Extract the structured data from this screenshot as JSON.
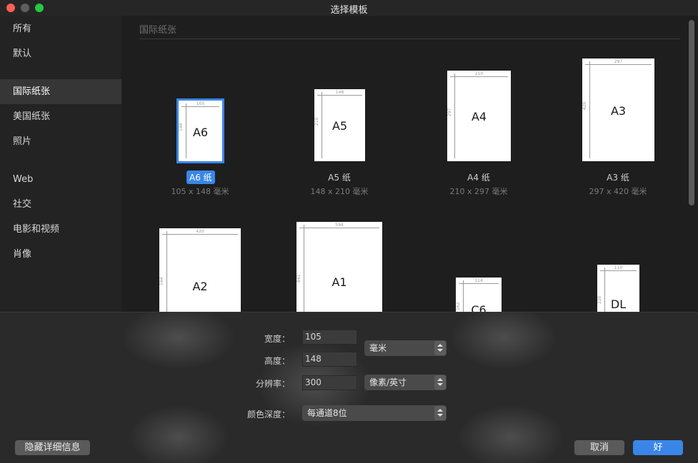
{
  "window": {
    "title": "选择模板"
  },
  "sidebar": {
    "items": [
      {
        "label": "所有"
      },
      {
        "label": "默认"
      },
      {
        "label": "国际纸张",
        "selected": true
      },
      {
        "label": "美国纸张"
      },
      {
        "label": "照片"
      },
      {
        "label": "Web"
      },
      {
        "label": "社交"
      },
      {
        "label": "电影和视频"
      },
      {
        "label": "肖像"
      }
    ]
  },
  "section": {
    "title": "国际纸张"
  },
  "templates": [
    {
      "name": "A6",
      "label": "A6 纸",
      "dims": "105 x 148 毫米",
      "w_num": "105",
      "h_num": "148",
      "selected": true
    },
    {
      "name": "A5",
      "label": "A5 纸",
      "dims": "148 x 210 毫米",
      "w_num": "148",
      "h_num": "210"
    },
    {
      "name": "A4",
      "label": "A4 纸",
      "dims": "210 x 297 毫米",
      "w_num": "210",
      "h_num": "297"
    },
    {
      "name": "A3",
      "label": "A3 纸",
      "dims": "297 x 420 毫米",
      "w_num": "297",
      "h_num": "420"
    },
    {
      "name": "A2",
      "w_num": "420",
      "h_num": "594"
    },
    {
      "name": "A1",
      "w_num": "594",
      "h_num": "841"
    },
    {
      "name": "C6",
      "w_num": "114",
      "h_num": "162"
    },
    {
      "name": "DL",
      "w_num": "110",
      "h_num": "220"
    }
  ],
  "details": {
    "width_label": "宽度：",
    "width_value": "105",
    "height_label": "高度：",
    "height_value": "148",
    "unit_select": "毫米",
    "resolution_label": "分辨率：",
    "resolution_value": "300",
    "resolution_unit_select": "像素/英寸",
    "color_depth_label": "颜色深度：",
    "color_depth_select": "每通道8位"
  },
  "buttons": {
    "hide_details": "隐藏详细信息",
    "cancel": "取消",
    "ok": "好"
  },
  "colors": {
    "accent": "#3a86e8",
    "background": "#1e1e1e"
  }
}
